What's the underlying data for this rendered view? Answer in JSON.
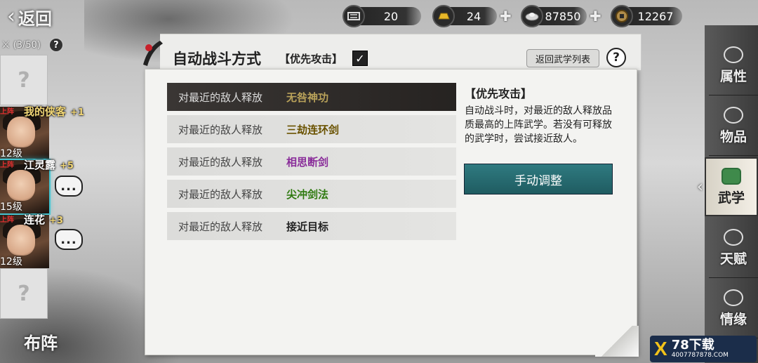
{
  "topbar": {
    "back_label": "返回",
    "resources": [
      {
        "icon": "scroll-icon",
        "value": "20",
        "has_plus": false
      },
      {
        "icon": "gold-ingot-icon",
        "value": "24",
        "has_plus": true
      },
      {
        "icon": "silver-ingot-icon",
        "value": "87850",
        "has_plus": true
      },
      {
        "icon": "coin-icon",
        "value": "12267",
        "has_plus": true
      }
    ]
  },
  "roster": {
    "count": "(3/50)",
    "help": "?",
    "empty_slot_mark": "?",
    "heroes": [
      {
        "badge": "上阵",
        "name": "我的侠客",
        "plus": "+1",
        "level": "12级",
        "name_style": "gold"
      },
      {
        "badge": "上阵",
        "name": "江灵露",
        "plus": "+5",
        "level": "15级",
        "name_style": "white"
      },
      {
        "badge": "上阵",
        "name": "连花",
        "plus": "+3",
        "level": "12级",
        "name_style": "white"
      }
    ],
    "chat_glyph": "...",
    "formation_label": "布阵"
  },
  "panel": {
    "title": "自动战斗方式",
    "mode_label": "【优先攻击】",
    "checkbox_checked": "✓",
    "return_button": "返回武学列表",
    "help_button": "?",
    "rows": [
      {
        "action": "对最近的敌人释放",
        "skill": "无咎神功",
        "color": "#b9a25a"
      },
      {
        "action": "对最近的敌人释放",
        "skill": "三劫连环剑",
        "color": "#6a5200"
      },
      {
        "action": "对最近的敌人释放",
        "skill": "相思断剑",
        "color": "#8a2e9a"
      },
      {
        "action": "对最近的敌人释放",
        "skill": "尖冲剑法",
        "color": "#2f7a10"
      },
      {
        "action": "对最近的敌人释放",
        "skill": "接近目标",
        "color": "#222222"
      }
    ],
    "desc_title": "【优先攻击】",
    "desc_text": "自动战斗时，对最近的敌人释放品质最高的上阵武学。若没有可释放的武学时，尝试接近敌人。",
    "manual_button": "手动调整"
  },
  "right_tabs": [
    {
      "label": "属性",
      "icon": "attributes-icon",
      "active": false
    },
    {
      "label": "物品",
      "icon": "items-icon",
      "active": false
    },
    {
      "label": "武学",
      "icon": "martial-arts-icon",
      "active": true
    },
    {
      "label": "天赋",
      "icon": "talent-icon",
      "active": false
    },
    {
      "label": "情缘",
      "icon": "bond-icon",
      "active": false
    }
  ],
  "watermark": {
    "logo": "X",
    "title": "78下载",
    "site": "4007787878.COM"
  }
}
